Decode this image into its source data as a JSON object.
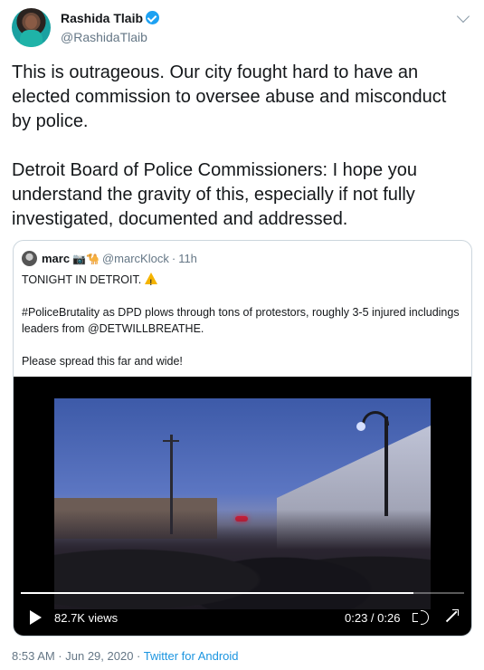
{
  "author": {
    "name": "Rashida Tlaib",
    "handle": "@RashidaTlaib"
  },
  "tweet": {
    "paragraphs": [
      "This is outrageous. Our city fought hard to have an elected commission to oversee abuse and misconduct by police.",
      "Detroit Board of Police Commissioners: I hope you understand the gravity of this, especially if not fully investigated, documented and addressed."
    ]
  },
  "quoted": {
    "name": "marc",
    "emoji": "📷🐪",
    "handle": "@marcKlock",
    "time": "11h",
    "line1": "TONIGHT IN DETROIT.",
    "line2": "#PoliceBrutality as DPD plows through tons of protestors, roughly 3-5 injured includings leaders from @DETWILLBREATHE.",
    "line3": "Please spread this far and wide!",
    "video": {
      "views": "82.7K views",
      "time": "0:23 / 0:26",
      "progress": 0.885
    }
  },
  "footer": {
    "timestamp": "8:53 AM · Jun 29, 2020 · ",
    "source": "Twitter for Android"
  },
  "colors": {
    "link": "#1b95e0",
    "verified": "#1da1f2",
    "secondary_text": "#657786"
  }
}
